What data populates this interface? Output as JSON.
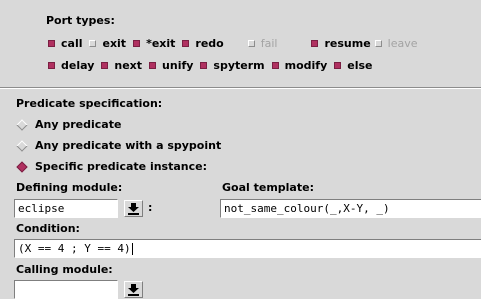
{
  "port_types": {
    "title": "Port types:",
    "row1": [
      {
        "label": "call",
        "checked": true,
        "enabled": true
      },
      {
        "label": "exit",
        "checked": false,
        "enabled": true
      },
      {
        "label": "*exit",
        "checked": true,
        "enabled": true
      },
      {
        "label": "redo",
        "checked": true,
        "enabled": true
      },
      {
        "label": "fail",
        "checked": false,
        "enabled": false
      },
      {
        "label": "resume",
        "checked": true,
        "enabled": true
      },
      {
        "label": "leave",
        "checked": false,
        "enabled": false
      }
    ],
    "row2": [
      {
        "label": "delay",
        "checked": true,
        "enabled": true
      },
      {
        "label": "next",
        "checked": true,
        "enabled": true
      },
      {
        "label": "unify",
        "checked": true,
        "enabled": true
      },
      {
        "label": "spyterm",
        "checked": true,
        "enabled": true
      },
      {
        "label": "modify",
        "checked": true,
        "enabled": true
      },
      {
        "label": "else",
        "checked": true,
        "enabled": true
      }
    ]
  },
  "predicate_spec": {
    "title": "Predicate specification:",
    "options": [
      {
        "label": "Any predicate",
        "selected": false
      },
      {
        "label": "Any predicate with a spypoint",
        "selected": false
      },
      {
        "label": "Specific predicate instance:",
        "selected": true
      }
    ]
  },
  "defining_module": {
    "label": "Defining module:",
    "value": "eclipse",
    "colon": ":"
  },
  "goal_template": {
    "label": "Goal template:",
    "value": "not_same_colour(_,X-Y, _)"
  },
  "condition": {
    "label": "Condition:",
    "value": "(X == 4 ; Y == 4)"
  },
  "calling_module": {
    "label": "Calling module:",
    "value": ""
  },
  "colors": {
    "accent": "#b03060",
    "background": "#d9d9d9"
  },
  "icons": {
    "menu_button": "down-arrow-with-bar-icon"
  }
}
